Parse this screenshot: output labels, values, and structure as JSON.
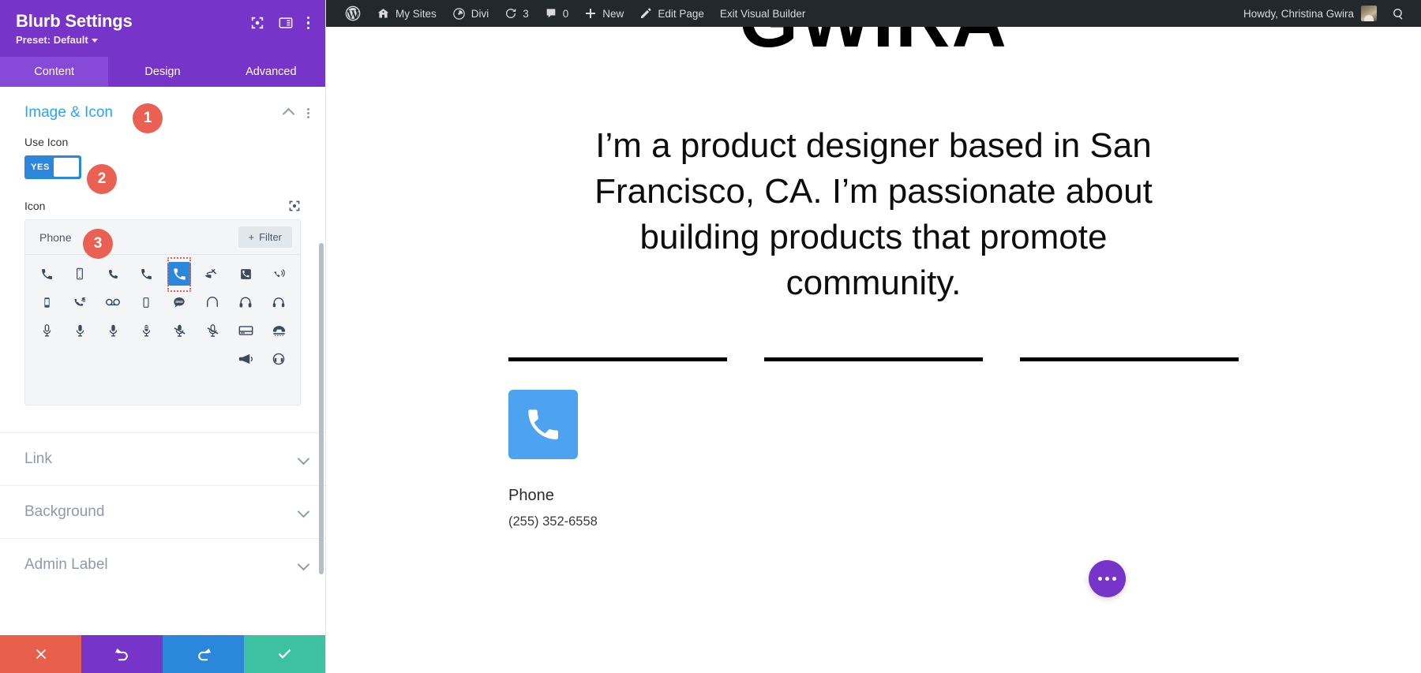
{
  "settings_panel": {
    "title": "Blurb Settings",
    "preset_label": "Preset: Default",
    "header_icons": [
      "focus-target-icon",
      "layout-columns-icon",
      "kebab-menu-icon"
    ],
    "tabs": [
      {
        "label": "Content",
        "active": true
      },
      {
        "label": "Design",
        "active": false
      },
      {
        "label": "Advanced",
        "active": false
      }
    ],
    "section": {
      "title": "Image & Icon",
      "expanded": true
    },
    "use_icon": {
      "label": "Use Icon",
      "value": "YES"
    },
    "icon_field": {
      "label": "Icon",
      "search_value": "Phone",
      "filter_label": "Filter",
      "selected_index": 4,
      "icons": [
        "phone-handset-icon",
        "mobile-phone-icon",
        "phone-call-icon",
        "phone-solid-icon",
        "phone-in-talk-icon",
        "phone-missed-icon",
        "phone-contact-icon",
        "phone-ringing-icon",
        "smartphone-icon",
        "phone-forward-icon",
        "voicemail-icon",
        "mobile-blank-icon",
        "sms-bubble-icon",
        "headphones-thin-icon",
        "headset-icon",
        "headphones-solid-icon",
        "microphone-outline-icon",
        "microphone-line-icon",
        "microphone-solid-icon",
        "microphone-alt-icon",
        "microphone-mute-icon",
        "microphone-off-icon",
        "answering-machine-icon",
        "rotary-phone-icon",
        "megaphone-icon",
        "support-headset-icon"
      ]
    },
    "accordions": [
      {
        "label": "Link"
      },
      {
        "label": "Background"
      },
      {
        "label": "Admin Label"
      }
    ],
    "actions": [
      {
        "name": "cancel",
        "icon": "close-icon",
        "color": "#e8604c"
      },
      {
        "name": "undo",
        "icon": "undo-icon",
        "color": "#7634c9"
      },
      {
        "name": "redo",
        "icon": "redo-icon",
        "color": "#2b87da"
      },
      {
        "name": "save",
        "icon": "check-icon",
        "color": "#3ec1a0"
      }
    ],
    "callouts": [
      {
        "number": "1"
      },
      {
        "number": "2"
      },
      {
        "number": "3"
      }
    ]
  },
  "adminbar": {
    "items": [
      {
        "label": "",
        "icon": "wordpress-logo-icon"
      },
      {
        "label": "My Sites",
        "icon": "sites-icon"
      },
      {
        "label": "Divi",
        "icon": "divi-icon"
      },
      {
        "label": "3",
        "icon": "updates-icon"
      },
      {
        "label": "0",
        "icon": "comment-icon"
      },
      {
        "label": "New",
        "icon": "plus-icon"
      },
      {
        "label": "Edit Page",
        "icon": "pencil-icon"
      },
      {
        "label": "Exit Visual Builder",
        "icon": ""
      }
    ],
    "howdy": "Howdy, Christina Gwira",
    "search_icon": "search-icon"
  },
  "site": {
    "logo_text": "GWIRA",
    "hero_text": "I’m a product designer based in San Francisco, CA. I’m passionate about building products that promote community.",
    "columns": [
      {
        "icon": "phone-in-talk-icon",
        "icon_color": "#4da3f0",
        "title": "Phone",
        "body": "(255) 352-6558"
      },
      {
        "icon": "",
        "title": "",
        "body": ""
      },
      {
        "icon": "",
        "title": "",
        "body": ""
      }
    ],
    "fab": "more-options-icon"
  },
  "colors": {
    "panel_purple": "#7634c9",
    "tab_active_purple": "#8749d8",
    "accent_blue": "#2ea3f2",
    "toggle_blue": "#2b87da",
    "callout_red": "#ea6153",
    "admin_bar": "#23282d",
    "icon_blue": "#4da3f0"
  }
}
